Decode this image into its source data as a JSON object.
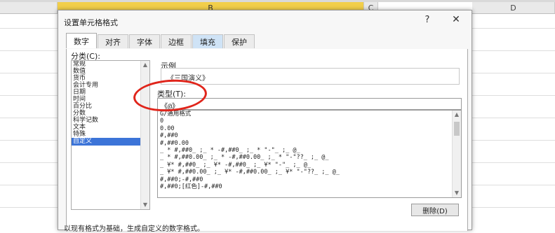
{
  "sheet": {
    "columns": [
      "B",
      "C",
      "D"
    ]
  },
  "dialog": {
    "title": "设置单元格格式",
    "help": "?",
    "close": "✕",
    "tabs": [
      "数字",
      "对齐",
      "字体",
      "边框",
      "填充",
      "保护"
    ],
    "category_label": "分类(C):",
    "categories": [
      "常规",
      "数值",
      "货币",
      "会计专用",
      "日期",
      "时间",
      "百分比",
      "分数",
      "科学记数",
      "文本",
      "特殊",
      "自定义"
    ],
    "selected_category": "自定义",
    "sample_label": "示例",
    "sample_value": "《三国演义》",
    "type_label": "类型(T):",
    "type_value": "《@》",
    "formats": [
      "G/通用格式",
      "0",
      "0.00",
      "#,##0",
      "#,##0.00",
      "_ * #,##0_ ;_ * -#,##0_ ;_ * \"-\"_ ;_ @_",
      "_ * #,##0.00_ ;_ * -#,##0.00_ ;_ * \"-\"??_ ;_ @_",
      "_ ¥* #,##0_ ;_ ¥* -#,##0_ ;_ ¥* \"-\"_ ;_ @_",
      "_ ¥* #,##0.00_ ;_ ¥* -#,##0.00_ ;_ ¥* \"-\"??_ ;_ @_",
      "#,##0;-#,##0",
      "#,##0;[红色]-#,##0"
    ],
    "delete_button": "删除(D)",
    "footer_text": "以现有格式为基础，生成自定义的数字格式。"
  },
  "colors": {
    "selected_column": "#f2cf4a",
    "selection_highlight": "#3c74d8",
    "annotation_circle": "#e0251b"
  }
}
